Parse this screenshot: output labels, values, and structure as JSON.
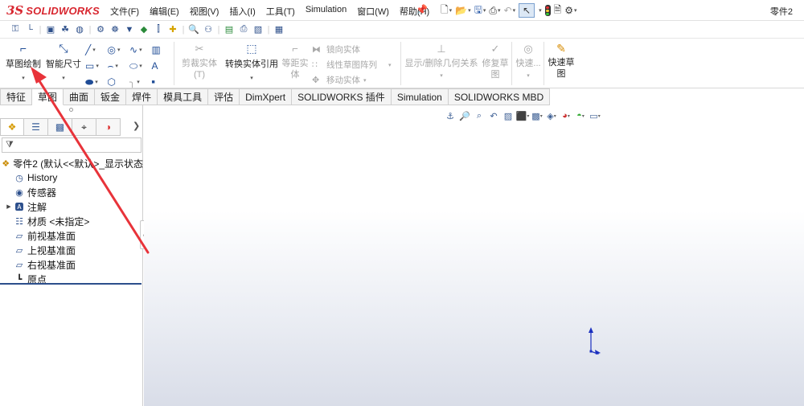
{
  "app": {
    "logo_mark": "3S",
    "logo_text": "SOLIDWORKS",
    "document_title": "零件2"
  },
  "menu": [
    "文件(F)",
    "编辑(E)",
    "视图(V)",
    "插入(I)",
    "工具(T)",
    "Simulation",
    "窗口(W)",
    "帮助(H)"
  ],
  "ribbon": {
    "sketch_label": "草图绘制",
    "smart_dim_label": "智能尺寸",
    "trim_label": "剪裁实体(T)",
    "convert_label": "转换实体引用",
    "offset_label_1": "等距实",
    "offset_label_2": "体",
    "mirror_label": "镜向实体",
    "linear_pattern_label": "线性草图阵列",
    "move_label": "移动实体",
    "relations_label": "显示/删除几何关系",
    "repair_label_1": "修复草",
    "repair_label_2": "图",
    "quick_snaps_label": "快速...",
    "rapid_sketch_label_1": "快速草",
    "rapid_sketch_label_2": "图"
  },
  "tabs": [
    "特征",
    "草图",
    "曲面",
    "钣金",
    "焊件",
    "模具工具",
    "评估",
    "DimXpert",
    "SOLIDWORKS 插件",
    "Simulation",
    "SOLIDWORKS MBD"
  ],
  "active_tab": "草图",
  "tree": [
    {
      "label": "零件2  (默认<<默认>_显示状态",
      "icon": "part-icon"
    },
    {
      "label": "History",
      "icon": "history-icon"
    },
    {
      "label": "传感器",
      "icon": "sensor-icon"
    },
    {
      "label": "注解",
      "icon": "annotation-icon"
    },
    {
      "label": "材质 <未指定>",
      "icon": "material-icon"
    },
    {
      "label": "前视基准面",
      "icon": "plane-icon"
    },
    {
      "label": "上视基准面",
      "icon": "plane-icon"
    },
    {
      "label": "右视基准面",
      "icon": "plane-icon"
    },
    {
      "label": "原点",
      "icon": "origin-icon"
    }
  ],
  "colors": {
    "brand": "#d8262f",
    "arrow": "#e8333a",
    "selection": "#2c4f8c"
  }
}
